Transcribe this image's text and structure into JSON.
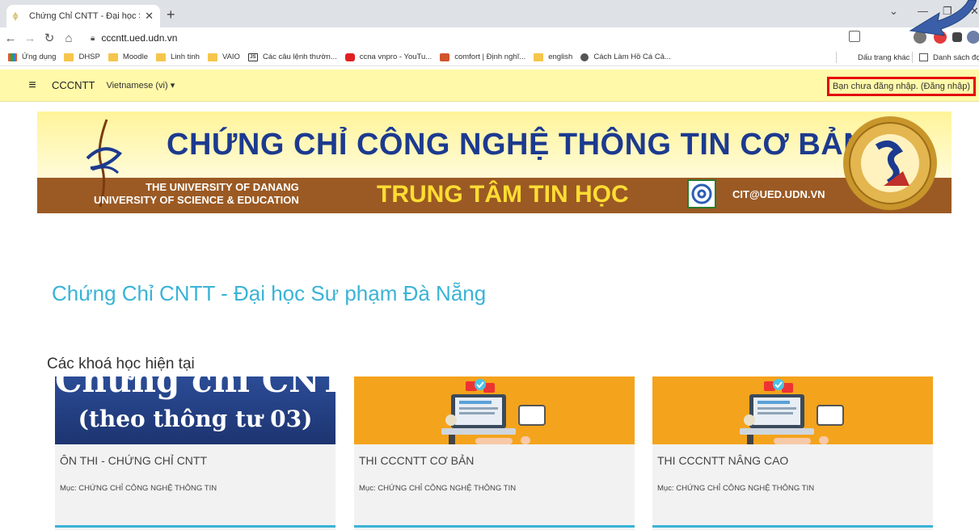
{
  "browser": {
    "tab_title": "Chứng Chỉ CNTT - Đại học Sư ph",
    "url": "cccntt.ued.udn.vn",
    "bookmarks": [
      {
        "label": "Ứng dụng",
        "icon": "apps-icon"
      },
      {
        "label": "DHSP",
        "icon": "folder-icon"
      },
      {
        "label": "Moodle",
        "icon": "folder-icon"
      },
      {
        "label": "Linh tinh",
        "icon": "folder-icon"
      },
      {
        "label": "VAIO",
        "icon": "folder-icon"
      },
      {
        "label": "Các câu lệnh thườn...",
        "icon": "js-icon"
      },
      {
        "label": "ccna vnpro - YouTu...",
        "icon": "youtube-icon"
      },
      {
        "label": "comfort | Định nghĩ...",
        "icon": "site-icon"
      },
      {
        "label": "english",
        "icon": "folder-icon"
      },
      {
        "label": "Cách Làm Hồ Cá Cả...",
        "icon": "globe-icon"
      }
    ],
    "bookmarks_right": {
      "other": "Dấu trang khác",
      "reading_list": "Danh sách đọ"
    }
  },
  "navbar": {
    "brand": "CCCNTT",
    "language": "Vietnamese (vi)",
    "login_text": "Bạn chưa đăng nhập. (Đăng nhập)"
  },
  "banner": {
    "title": "CHỨNG CHỈ CÔNG NGHỆ THÔNG TIN CƠ BẢN",
    "university_line1": "THE UNIVERSITY OF DANANG",
    "university_line2": "UNIVERSITY OF SCIENCE & EDUCATION",
    "center": "TRUNG TÂM TIN HỌC",
    "email": "CIT@UED.UDN.VN"
  },
  "main": {
    "page_title": "Chứng Chỉ CNTT - Đại học Sư phạm Đà Nẵng",
    "section_title": "Các khoá học hiện tại",
    "courses": [
      {
        "name": "ÔN THI - CHỨNG CHỈ CNTT",
        "category": "Mục: CHỨNG CHỈ CÔNG NGHỆ THÔNG TIN",
        "image_line1": "Chứng chỉ CNTT",
        "image_line2": "(theo thông tư 03)"
      },
      {
        "name": "THI CCCNTT CƠ BẢN",
        "category": "Mục: CHỨNG CHỈ CÔNG NGHỆ THÔNG TIN"
      },
      {
        "name": "THI CCCNTT NÂNG CAO",
        "category": "Mục: CHỨNG CHỈ CÔNG NGHỆ THÔNG TIN"
      }
    ]
  },
  "colors": {
    "navbar_bg": "#fff9a9",
    "login_highlight": "#e3060d",
    "accent": "#3ab3d6",
    "banner_brown": "#9b5a24",
    "banner_title": "#1c3a8f",
    "course_orange": "#f4a31c"
  }
}
